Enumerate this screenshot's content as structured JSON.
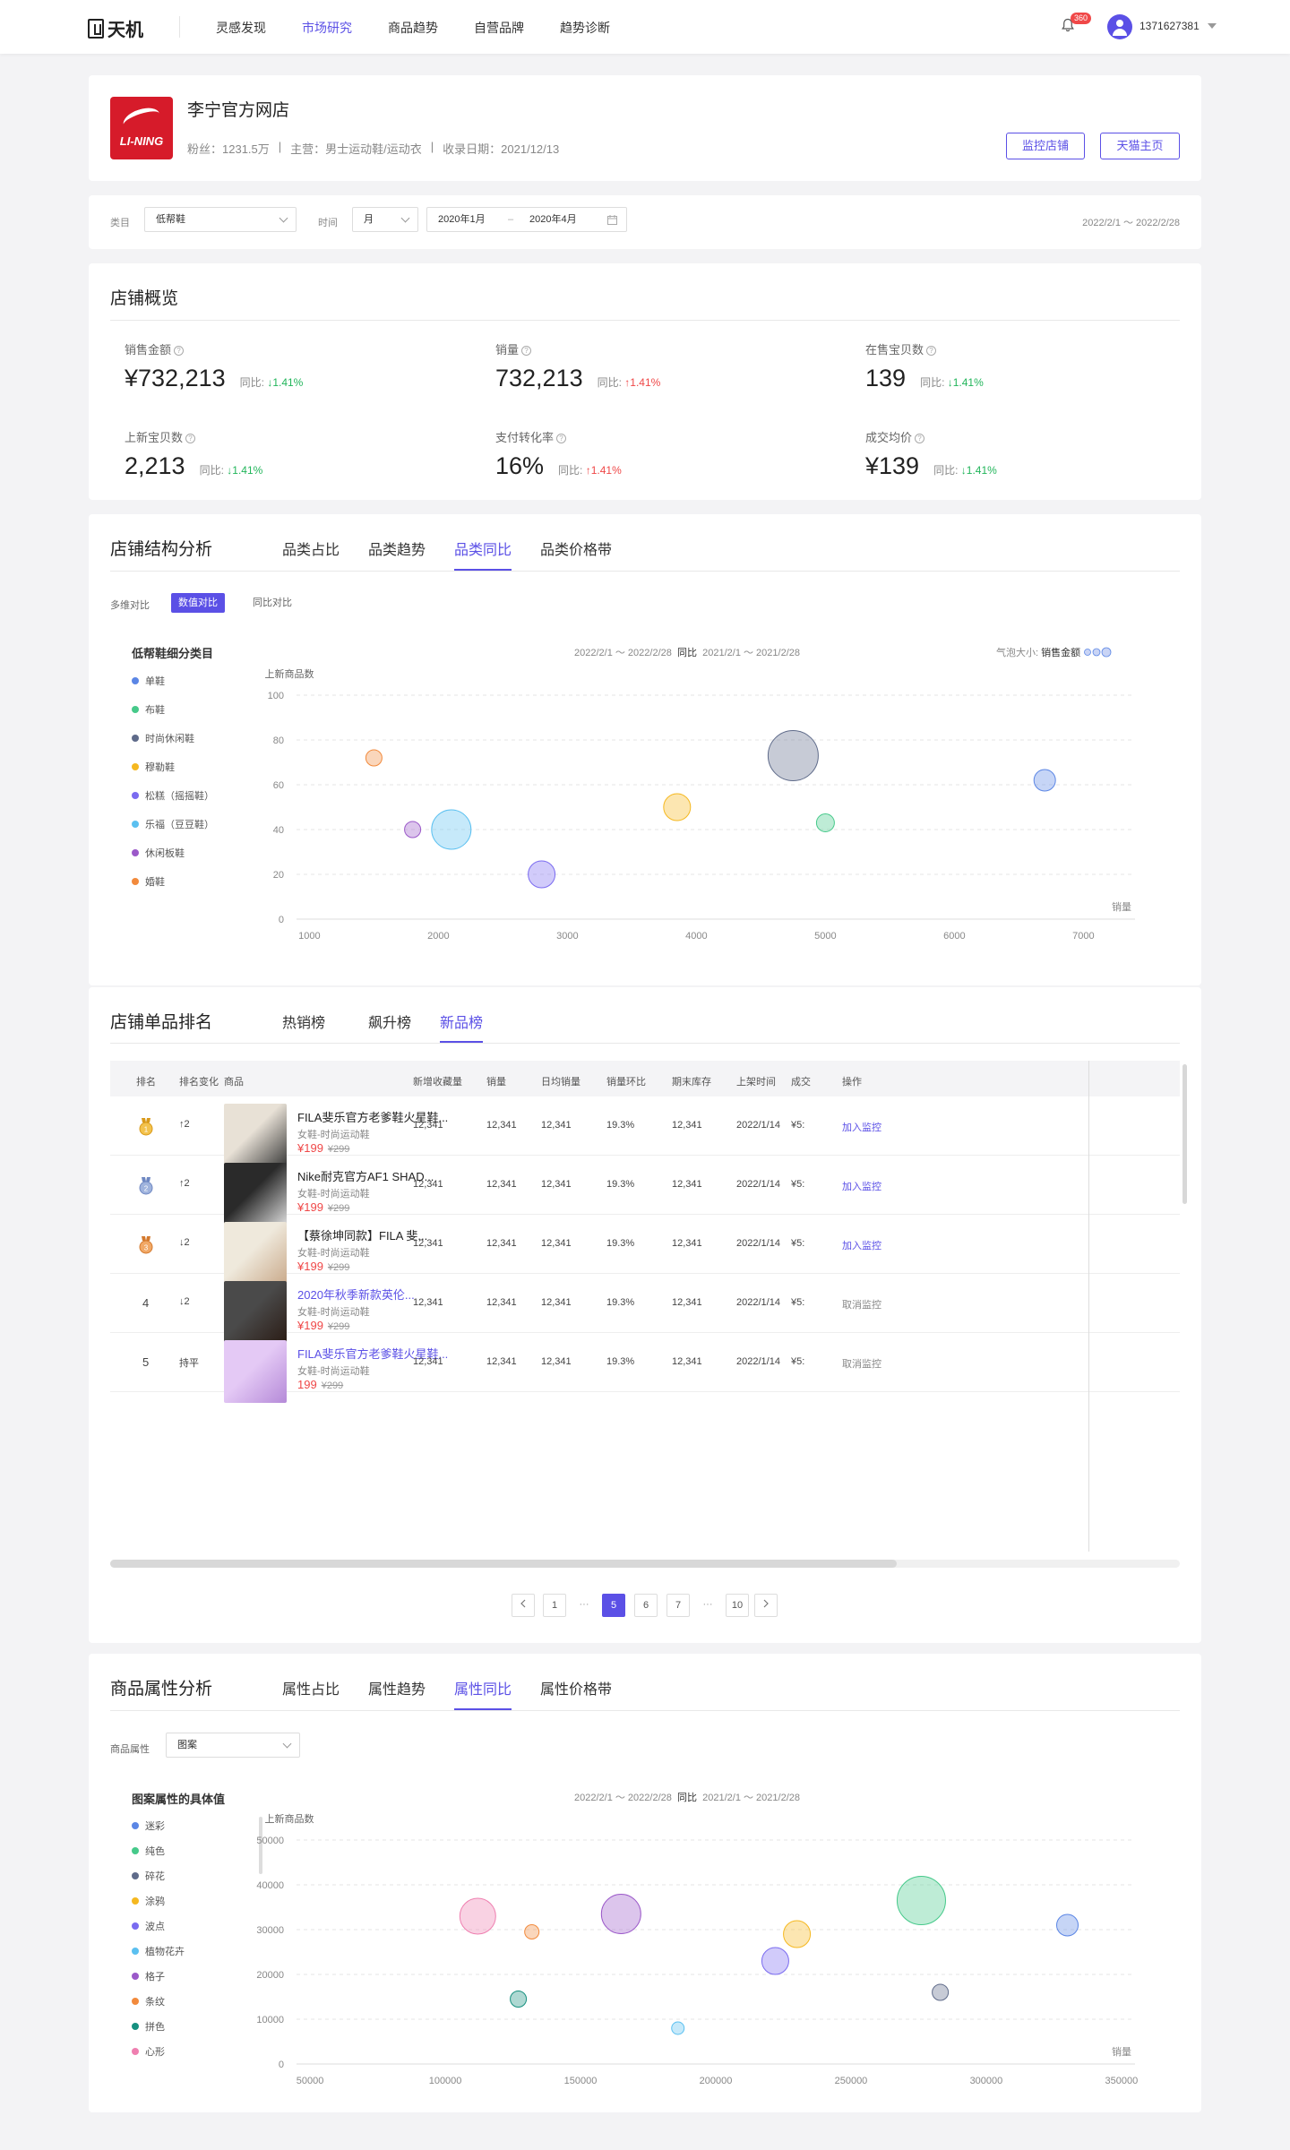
{
  "nav": {
    "logo_text": "天机",
    "items": [
      "灵感发现",
      "市场研究",
      "商品趋势",
      "自营品牌",
      "趋势诊断"
    ],
    "active_index": 1,
    "notification_count": "360",
    "username": "1371627381"
  },
  "shop": {
    "logo_text": "LI-NING",
    "name": "李宁官方网店",
    "fans": "粉丝：1231.5万",
    "sep1": "|",
    "category": "主营：男士运动鞋/运动衣",
    "sep2": "|",
    "date": "收录日期：2021/12/13",
    "monitor_btn": "监控店铺",
    "tmall_btn": "天猫主页"
  },
  "filters": {
    "category_label": "类目",
    "category_value": "低帮鞋",
    "time_label": "时间",
    "period_value": "月",
    "start": "2020年1月",
    "range_sep": "–",
    "end": "2020年4月",
    "range_text": "2022/2/1 ～ 2022/2/28"
  },
  "overview": {
    "title": "店铺概览",
    "yoy_label": "同比:",
    "kpis": [
      {
        "label": "销售金额",
        "value": "¥732,213",
        "change": "↓1.41%",
        "dir": "down"
      },
      {
        "label": "销量",
        "value": "732,213",
        "change": "↑1.41%",
        "dir": "up"
      },
      {
        "label": "在售宝贝数",
        "value": "139",
        "change": "↓1.41%",
        "dir": "down"
      },
      {
        "label": "上新宝贝数",
        "value": "2,213",
        "change": "↓1.41%",
        "dir": "down"
      },
      {
        "label": "支付转化率",
        "value": "16%",
        "change": "↑1.41%",
        "dir": "up"
      },
      {
        "label": "成交均价",
        "value": "¥139",
        "change": "↓1.41%",
        "dir": "down"
      }
    ]
  },
  "structure": {
    "title": "店铺结构分析",
    "tabs": [
      "品类占比",
      "品类趋势",
      "品类同比",
      "品类价格带"
    ],
    "active_tab": 2,
    "compare_label": "多维对比",
    "compare_opts": [
      "数值对比",
      "同比对比"
    ],
    "legend_title": "低帮鞋细分类目",
    "date_a": "2022/2/1 ～ 2022/2/28",
    "vs": "同比",
    "date_b": "2021/2/1 ～ 2021/2/28",
    "bubble_label": "气泡大小:",
    "bubble_metric": "销售金额"
  },
  "ranking": {
    "title": "店铺单品排名",
    "tabs": [
      "热销榜",
      "飙升榜",
      "新品榜"
    ],
    "active_tab": 2,
    "headers": [
      "排名",
      "排名变化",
      "商品",
      "新增收藏量",
      "销量",
      "日均销量",
      "销量环比",
      "期末库存",
      "上架时间",
      "成交",
      "操作"
    ],
    "rows": [
      {
        "rank": "1",
        "change": "↑2",
        "dir": "up",
        "name": "FILA斐乐官方老爹鞋火星鞋...",
        "link": false,
        "sub": "女鞋-时尚运动鞋",
        "price": "¥199",
        "orig": "¥299",
        "fav": "12,341",
        "sales": "12,341",
        "daily": "12,341",
        "mom": "19.3%",
        "stock": "12,341",
        "date": "2022/1/14",
        "deal": "¥5:",
        "op": "加入监控",
        "op_gray": false
      },
      {
        "rank": "2",
        "change": "↑2",
        "dir": "up",
        "name": "Nike耐克官方AF1 SHAD...",
        "link": false,
        "sub": "女鞋-时尚运动鞋",
        "price": "¥199",
        "orig": "¥299",
        "fav": "12,341",
        "sales": "12,341",
        "daily": "12,341",
        "mom": "19.3%",
        "stock": "12,341",
        "date": "2022/1/14",
        "deal": "¥5:",
        "op": "加入监控",
        "op_gray": false
      },
      {
        "rank": "3",
        "change": "↓2",
        "dir": "down",
        "name": "【蔡徐坤同款】FILA 斐...",
        "link": false,
        "sub": "女鞋-时尚运动鞋",
        "price": "¥199",
        "orig": "¥299",
        "fav": "12,341",
        "sales": "12,341",
        "daily": "12,341",
        "mom": "19.3%",
        "stock": "12,341",
        "date": "2022/1/14",
        "deal": "¥5:",
        "op": "加入监控",
        "op_gray": false
      },
      {
        "rank": "4",
        "change": "↓2",
        "dir": "down",
        "name": "2020年秋季新款英伦...",
        "link": true,
        "sub": "女鞋-时尚运动鞋",
        "price": "¥199",
        "orig": "¥299",
        "fav": "12,341",
        "sales": "12,341",
        "daily": "12,341",
        "mom": "19.3%",
        "stock": "12,341",
        "date": "2022/1/14",
        "deal": "¥5:",
        "op": "取消监控",
        "op_gray": true
      },
      {
        "rank": "5",
        "change": "持平",
        "dir": "flat",
        "name": "FILA斐乐官方老爹鞋火星鞋...",
        "link": true,
        "sub": "女鞋-时尚运动鞋",
        "price": "199",
        "orig": "¥299",
        "fav": "12,341",
        "sales": "12,341",
        "daily": "12,341",
        "mom": "19.3%",
        "stock": "12,341",
        "date": "2022/1/14",
        "deal": "¥5:",
        "op": "取消监控",
        "op_gray": true
      }
    ],
    "pagination": [
      "1",
      "···",
      "5",
      "6",
      "7",
      "···",
      "10"
    ],
    "active_page": "5"
  },
  "attributes": {
    "title": "商品属性分析",
    "tabs": [
      "属性占比",
      "属性趋势",
      "属性同比",
      "属性价格带"
    ],
    "active_tab": 2,
    "attr_label": "商品属性",
    "attr_value": "图案",
    "legend_title": "图案属性的具体值",
    "date_a": "2022/2/1 ～ 2022/2/28",
    "vs": "同比",
    "date_b": "2021/2/1 ～ 2021/2/28"
  },
  "chart_data": [
    {
      "type": "scatter",
      "ylabel": "上新商品数",
      "xlabel": "销量",
      "xlim": [
        900,
        7400
      ],
      "ylim": [
        0,
        100
      ],
      "xticks": [
        1000,
        2000,
        3000,
        4000,
        5000,
        6000,
        7000
      ],
      "yticks": [
        0,
        20,
        40,
        60,
        80,
        100
      ],
      "grid": true,
      "series": [
        {
          "name": "单鞋",
          "color": "#5b86e5",
          "x": 6700,
          "y": 62,
          "size": 12
        },
        {
          "name": "布鞋",
          "color": "#46c98a",
          "x": 5000,
          "y": 43,
          "size": 10
        },
        {
          "name": "时尚休闲鞋",
          "color": "#5f6b8a",
          "x": 4750,
          "y": 73,
          "size": 28
        },
        {
          "name": "穆勒鞋",
          "color": "#f5b820",
          "x": 3850,
          "y": 50,
          "size": 15
        },
        {
          "name": "松糕（摇摇鞋）",
          "color": "#7a6bf0",
          "x": 2800,
          "y": 20,
          "size": 15
        },
        {
          "name": "乐福（豆豆鞋）",
          "color": "#5bc0f0",
          "x": 2100,
          "y": 40,
          "size": 22
        },
        {
          "name": "休闲板鞋",
          "color": "#9b59c9",
          "x": 1800,
          "y": 40,
          "size": 9
        },
        {
          "name": "婚鞋",
          "color": "#f28a3c",
          "x": 1500,
          "y": 72,
          "size": 9
        }
      ]
    },
    {
      "type": "scatter",
      "ylabel": "上新商品数",
      "xlabel": "销量",
      "xlim": [
        45000,
        355000
      ],
      "ylim": [
        0,
        50000
      ],
      "xticks": [
        50000,
        100000,
        150000,
        200000,
        250000,
        300000,
        350000
      ],
      "yticks": [
        0,
        10000,
        20000,
        30000,
        40000,
        50000
      ],
      "grid": true,
      "series": [
        {
          "name": "迷彩",
          "color": "#5b86e5",
          "x": 330000,
          "y": 31000,
          "size": 12
        },
        {
          "name": "纯色",
          "color": "#46c98a",
          "x": 276000,
          "y": 36500,
          "size": 27
        },
        {
          "name": "碎花",
          "color": "#5f6b8a",
          "x": 283000,
          "y": 16000,
          "size": 9
        },
        {
          "name": "涂鸦",
          "color": "#f5b820",
          "x": 230000,
          "y": 29000,
          "size": 15
        },
        {
          "name": "波点",
          "color": "#7a6bf0",
          "x": 222000,
          "y": 23000,
          "size": 15
        },
        {
          "name": "植物花卉",
          "color": "#5bc0f0",
          "x": 186000,
          "y": 8000,
          "size": 7
        },
        {
          "name": "格子",
          "color": "#9b59c9",
          "x": 165000,
          "y": 33500,
          "size": 22
        },
        {
          "name": "条纹",
          "color": "#f28a3c",
          "x": 132000,
          "y": 29500,
          "size": 8
        },
        {
          "name": "拼色",
          "color": "#16907f",
          "x": 127000,
          "y": 14500,
          "size": 9
        },
        {
          "name": "心形",
          "color": "#ef7fb0",
          "x": 112000,
          "y": 33000,
          "size": 20
        }
      ]
    }
  ]
}
